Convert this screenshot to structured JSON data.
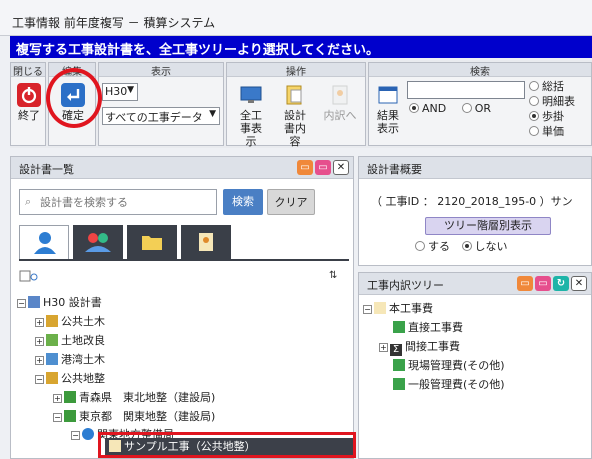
{
  "window": {
    "title": "工事情報 前年度複写 － 積算システム"
  },
  "banner": {
    "text": "複写する工事設計書を、全工事ツリーより選択してください。"
  },
  "ribbon": {
    "close_group": "閉じる",
    "close_label": "終了",
    "confirm_group": "編集",
    "confirm_label": "確定",
    "display_group": "表示",
    "year_value": "H30",
    "filter_value": "すべての工事データ",
    "ops_group": "操作",
    "ops": {
      "all_show": "全工事表示",
      "design_content": "設計書内容",
      "to_internal": "内訳へ"
    },
    "search_group": "検索",
    "search_results": "結果表示",
    "and_label": "AND",
    "or_label": "OR",
    "levels": [
      "総括",
      "明細表",
      "歩掛",
      "単価"
    ]
  },
  "left_panel": {
    "title": "設計書一覧",
    "search_placeholder": "設計書を検索する",
    "search_button": "検索",
    "clear_button": "クリア",
    "tree": {
      "root": "H30 設計書",
      "n1": "公共土木",
      "n2": "土地改良",
      "n3": "港湾土木",
      "n4": "公共地整",
      "n5": "青森県　東北地整（建設局)",
      "n6": "東京都　関東地整（建設局)",
      "n7": "関東地方整備局",
      "n8": "サンプル工事（公共地整）"
    }
  },
  "right_top": {
    "title": "設計書概要",
    "id_line": "（ 工事ID ： 2120_2018_195-0 ）サン",
    "tree_button": "ツリー階層別表示",
    "opt_yes": "する",
    "opt_no": "しない"
  },
  "right_bottom": {
    "title": "工事内訳ツリー",
    "items": [
      "本工事費",
      "直接工事費",
      "間接工事費",
      "現場管理費(その他)",
      "一般管理費(その他)"
    ]
  }
}
